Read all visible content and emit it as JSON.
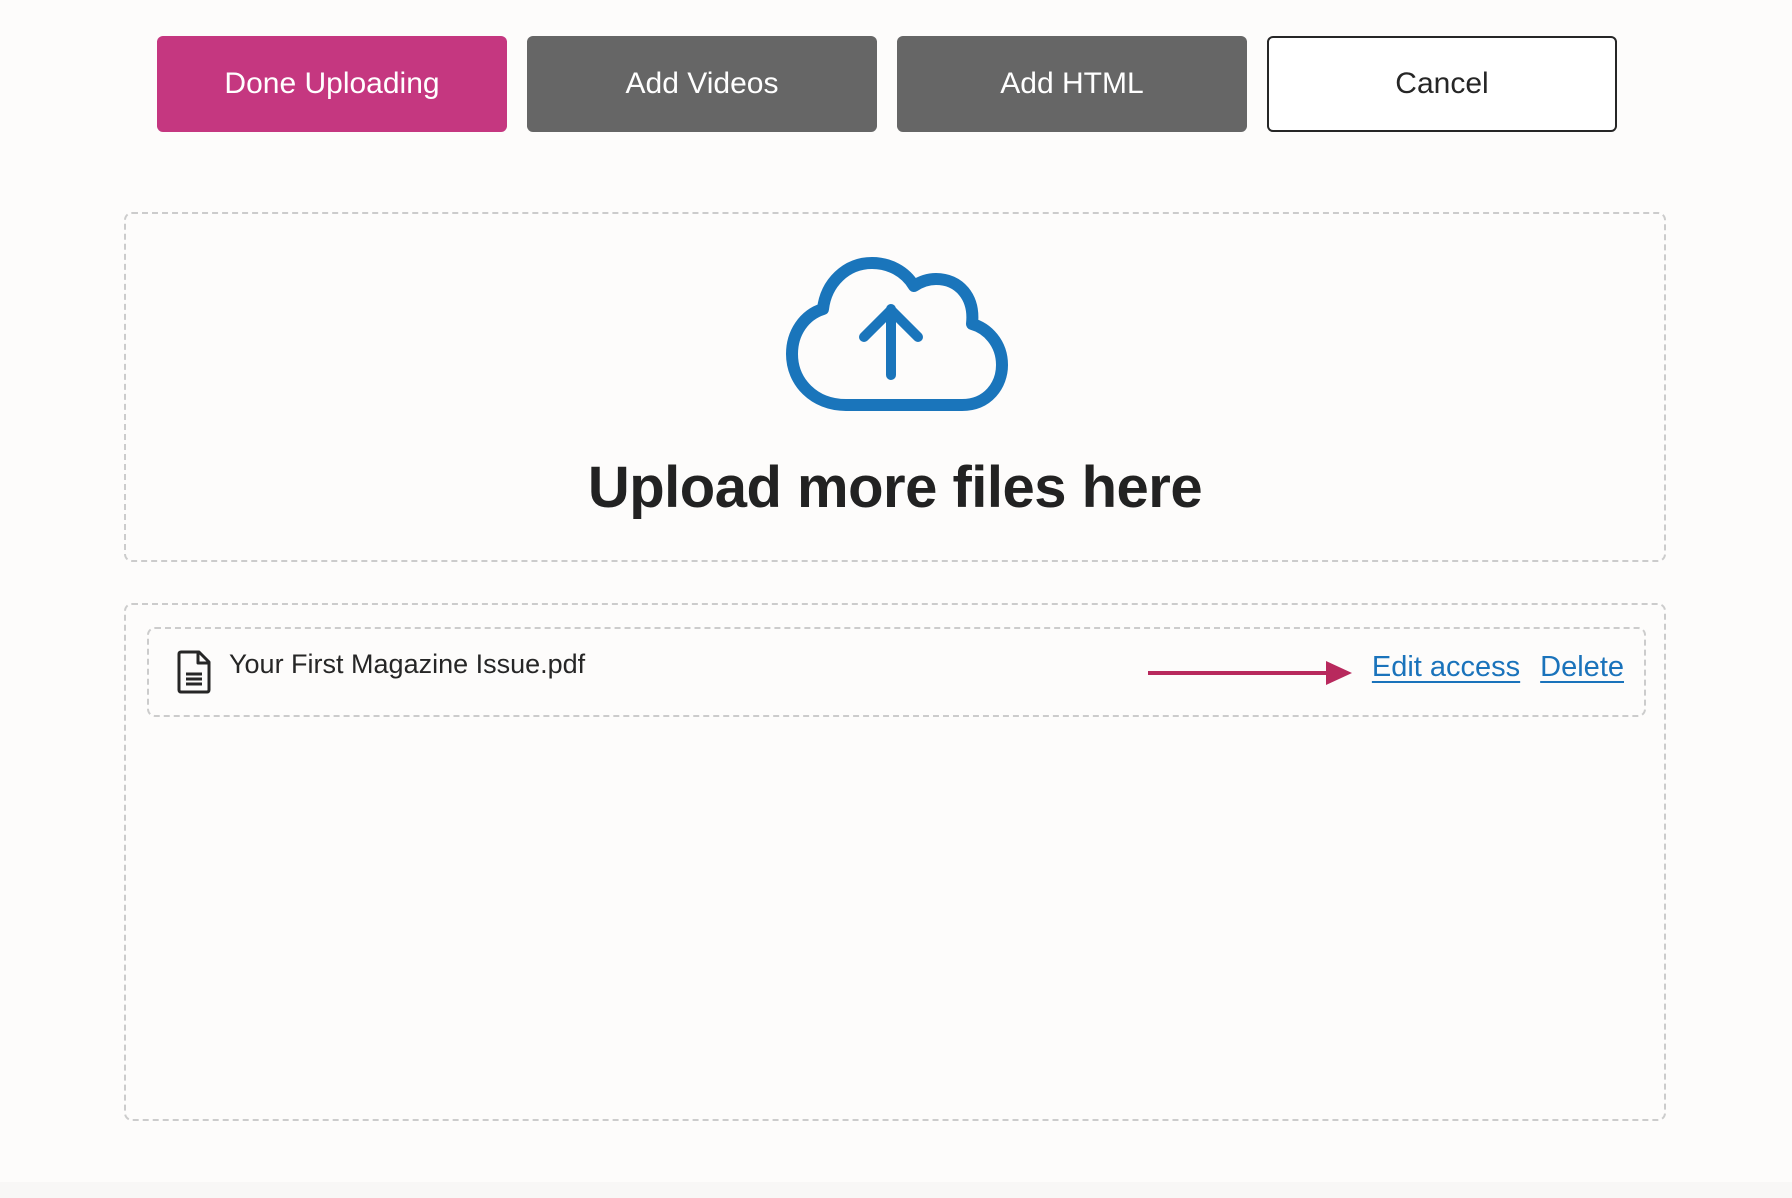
{
  "toolbar": {
    "done_uploading_label": "Done Uploading",
    "add_videos_label": "Add Videos",
    "add_html_label": "Add HTML",
    "cancel_label": "Cancel"
  },
  "dropzone": {
    "icon": "cloud-upload-icon",
    "title": "Upload more files here"
  },
  "files": [
    {
      "icon": "document-icon",
      "name": "Your First Magazine Issue.pdf",
      "annotation": "arrow-right-icon",
      "actions": {
        "edit_access_label": "Edit access",
        "delete_label": "Delete"
      }
    }
  ],
  "colors": {
    "primary": "#c53780",
    "secondary": "#666666",
    "link": "#1a73bb",
    "icon_blue": "#1a75bb",
    "annotation_arrow": "#b8295d",
    "dashed_border": "#cccccc"
  }
}
